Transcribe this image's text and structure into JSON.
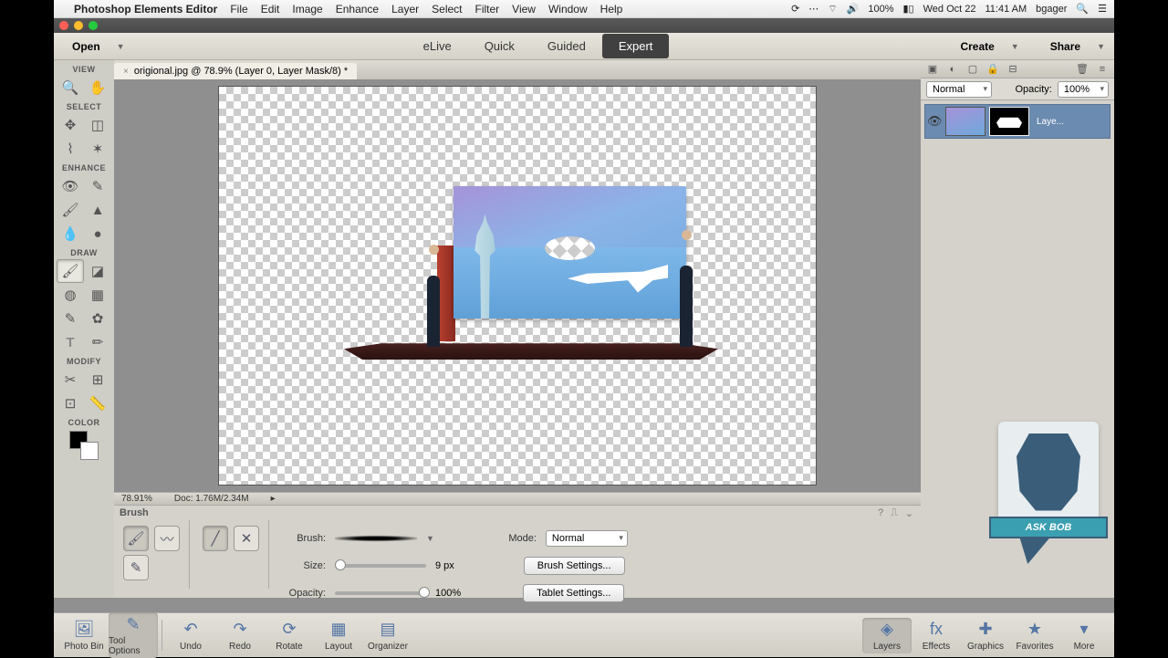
{
  "menubar": {
    "app_name": "Photoshop Elements Editor",
    "items": [
      "File",
      "Edit",
      "Image",
      "Enhance",
      "Layer",
      "Select",
      "Filter",
      "View",
      "Window",
      "Help"
    ],
    "right": {
      "battery": "100%",
      "date": "Wed Oct 22",
      "time": "11:41 AM",
      "user": "bgager"
    }
  },
  "appbar": {
    "open": "Open",
    "modes": {
      "elive": "eLive",
      "quick": "Quick",
      "guided": "Guided",
      "expert": "Expert"
    },
    "create": "Create",
    "share": "Share"
  },
  "toolbox": {
    "sections": {
      "view": "VIEW",
      "select": "SELECT",
      "enhance": "ENHANCE",
      "draw": "DRAW",
      "modify": "MODIFY",
      "color": "COLOR"
    }
  },
  "document": {
    "tab_title": "origional.jpg @ 78.9% (Layer 0, Layer Mask/8) *",
    "zoom": "78.91%",
    "docinfo": "Doc: 1.76M/2.34M"
  },
  "options": {
    "title": "Brush",
    "brush_label": "Brush:",
    "size_label": "Size:",
    "size_value": "9 px",
    "opacity_label": "Opacity:",
    "opacity_value": "100%",
    "mode_label": "Mode:",
    "mode_value": "Normal",
    "brush_settings": "Brush Settings...",
    "tablet_settings": "Tablet Settings..."
  },
  "layers": {
    "blend_mode": "Normal",
    "opacity_label": "Opacity:",
    "opacity_value": "100%",
    "item_name": "Laye..."
  },
  "askbob": {
    "label": "ASK BOB"
  },
  "bottombar": {
    "photo_bin": "Photo Bin",
    "tool_options": "Tool Options",
    "undo": "Undo",
    "redo": "Redo",
    "rotate": "Rotate",
    "layout": "Layout",
    "organizer": "Organizer",
    "layers": "Layers",
    "effects": "Effects",
    "graphics": "Graphics",
    "favorites": "Favorites",
    "more": "More"
  }
}
